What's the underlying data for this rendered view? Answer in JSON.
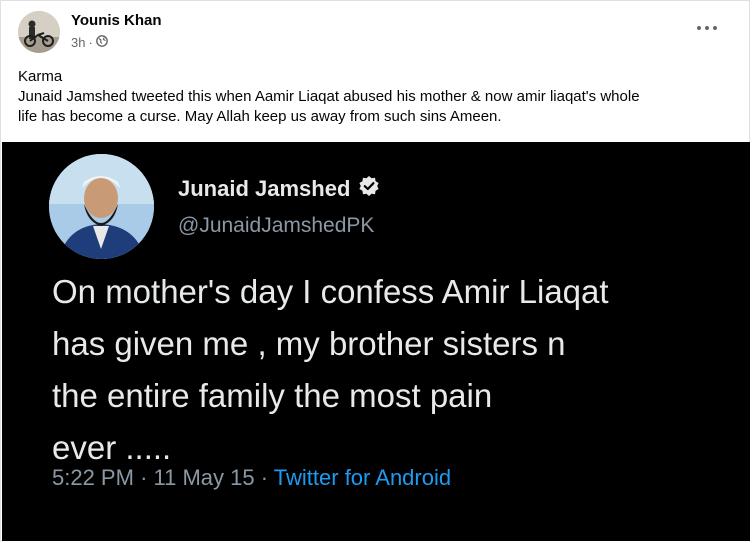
{
  "post": {
    "author": "Younis Khan",
    "time": "3h",
    "separator": "·",
    "audience_icon": "globe-icon",
    "more_icon": "more-horizontal-icon",
    "caption_lines": [
      "Karma",
      "Junaid Jamshed tweeted this when Aamir Liaqat abused his mother & now amir liaqat's whole",
      "life has become a curse. May Allah keep us away from such sins Ameen."
    ]
  },
  "tweet": {
    "name": "Junaid Jamshed",
    "verified_icon": "verified-badge-icon",
    "handle": "@JunaidJamshedPK",
    "text_lines": [
      "On mother's day I confess Amir Liaqat",
      "has given me , my brother sisters n",
      "the entire family the most pain",
      "ever ....."
    ],
    "time": "5:22 PM",
    "dot": "·",
    "date": "11 May 15",
    "dot2": "·",
    "source": "Twitter for Android"
  },
  "colors": {
    "tweet_bg": "#000000",
    "tweet_text": "#e7e9ea",
    "tweet_muted": "#8b98a5",
    "tweet_link": "#1d9bf0",
    "fb_muted": "#65676b"
  }
}
